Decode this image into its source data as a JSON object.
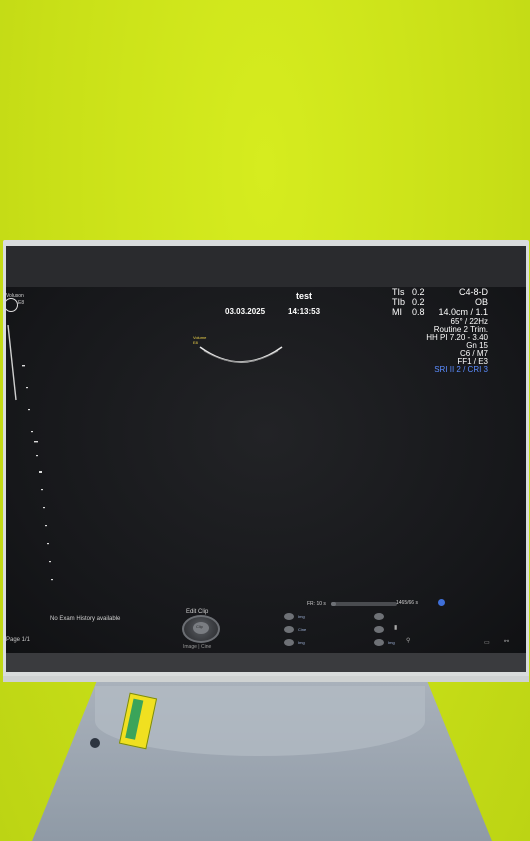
{
  "header": {
    "brand": "Voluson",
    "brand_sub": "E8",
    "patient_name": "test",
    "date": "03.03.2025",
    "time": "14:13:53"
  },
  "thermal": [
    {
      "label": "TIs",
      "value": "0.2"
    },
    {
      "label": "TIb",
      "value": "0.2"
    },
    {
      "label": "MI",
      "value": "0.8"
    }
  ],
  "probe_params": [
    "C4-8-D",
    "OB",
    "14.0cm / 1.1",
    "65° / 22Hz",
    "Routine 2 Trim.",
    "HH PI 7.20 - 3.40",
    "Gn 15",
    "C6 / M7",
    "FF1 / E3",
    "SRI II 2 / CRI 3"
  ],
  "volume_label": {
    "line1": "Volume",
    "line2": "E8"
  },
  "footer": {
    "history": "No Exam History available",
    "page": "Page 1/1",
    "edit_clip": "Edit Clip",
    "knob_label": "Clip",
    "image_cine": "Image | Cine",
    "frame_rate": "FR: 10 s",
    "frames": "1465/66 s",
    "progress_fraction": 0.08
  },
  "side_buttons": [
    {
      "label": "Img"
    },
    {
      "label": "Cine"
    },
    {
      "label": "Img"
    }
  ],
  "right_buttons": [
    {
      "label": ""
    },
    {
      "label": ""
    },
    {
      "label": "Img"
    }
  ],
  "colors": {
    "wall": "#cde419",
    "screen": "#16171a",
    "highlight_blue": "#5b8cff",
    "volume_yellow": "#f0d44a"
  }
}
